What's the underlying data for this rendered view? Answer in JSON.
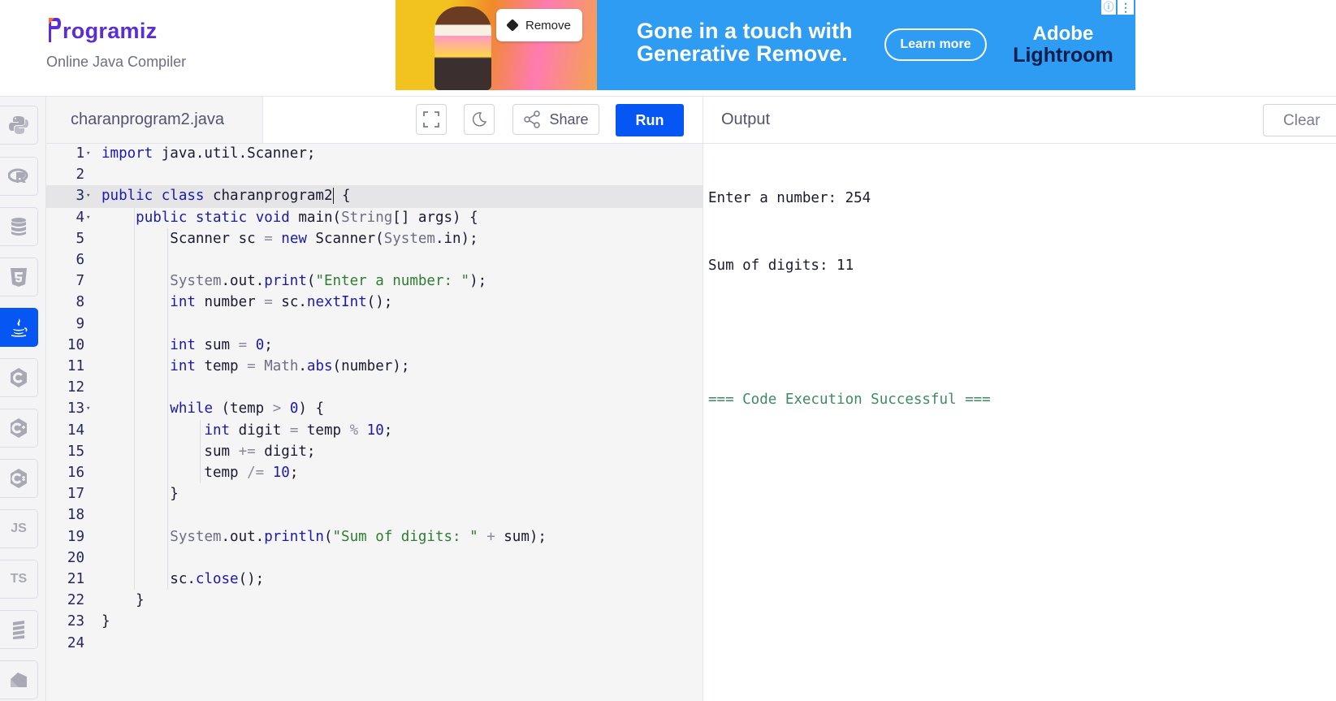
{
  "header": {
    "logo_text": "rogramiz",
    "subtitle": "Online Java Compiler"
  },
  "ad": {
    "remove_label": "Remove",
    "headline_line1": "Gone in a touch with",
    "headline_line2": "Generative Remove.",
    "cta_label": "Learn more",
    "brand_line1": "Adobe",
    "brand_line2": "Lightroom",
    "colors": {
      "background": "#2e9cf2"
    }
  },
  "sidebar": {
    "items": [
      {
        "name": "python",
        "icon": "python-icon",
        "label": ""
      },
      {
        "name": "r",
        "icon": "r-icon",
        "label": ""
      },
      {
        "name": "sql",
        "icon": "database-icon",
        "label": ""
      },
      {
        "name": "html",
        "icon": "html5-icon",
        "label": ""
      },
      {
        "name": "java",
        "icon": "java-icon",
        "label": "",
        "active": true
      },
      {
        "name": "c",
        "icon": "c-icon",
        "label": ""
      },
      {
        "name": "cpp",
        "icon": "cpp-icon",
        "label": ""
      },
      {
        "name": "csharp",
        "icon": "csharp-icon",
        "label": ""
      },
      {
        "name": "javascript",
        "icon": "js-icon",
        "label": "JS"
      },
      {
        "name": "typescript",
        "icon": "ts-icon",
        "label": "TS"
      },
      {
        "name": "go",
        "icon": "go-icon",
        "label": ""
      },
      {
        "name": "kotlin",
        "icon": "kotlin-icon",
        "label": ""
      }
    ]
  },
  "editor": {
    "file_name": "charanprogram2.java",
    "share_label": "Share",
    "run_label": "Run",
    "active_line": 3,
    "lines": [
      "import java.util.Scanner;",
      "",
      "public class charanprogram2 {",
      "    public static void main(String[] args) {",
      "        Scanner sc = new Scanner(System.in);",
      "",
      "        System.out.print(\"Enter a number: \");",
      "        int number = sc.nextInt();",
      "",
      "        int sum = 0;",
      "        int temp = Math.abs(number);",
      "",
      "        while (temp > 0) {",
      "            int digit = temp % 10;",
      "            sum += digit;",
      "            temp /= 10;",
      "        }",
      "",
      "        System.out.println(\"Sum of digits: \" + sum);",
      "",
      "        sc.close();",
      "    }",
      "}",
      ""
    ]
  },
  "output": {
    "title": "Output",
    "clear_label": "Clear",
    "lines": [
      "Enter a number: 254",
      "Sum of digits: 11",
      ""
    ],
    "success_line": "=== Code Execution Successful ==="
  },
  "colors": {
    "accent": "#0556f3",
    "brand": "#5a2dd6",
    "success": "#3f8a62"
  }
}
